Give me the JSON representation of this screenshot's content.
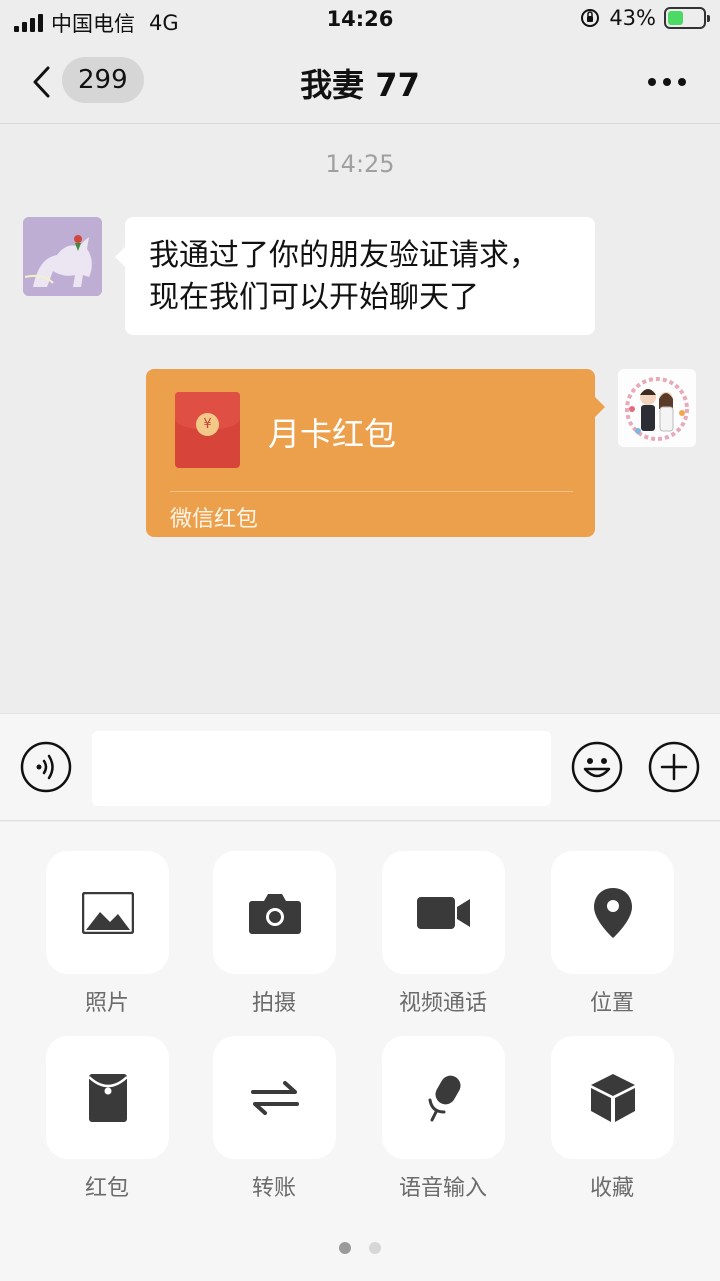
{
  "status_bar": {
    "carrier": "中国电信",
    "network": "4G",
    "time": "14:26",
    "battery_percent": "43%",
    "battery_level": 0.43
  },
  "nav": {
    "unread_count": "299",
    "title": "我妻 77"
  },
  "chat": {
    "timestamp": "14:25",
    "incoming_message_line1": "我通过了你的朋友验证请求，",
    "incoming_message_line2": "现在我们可以开始聊天了",
    "red_packet": {
      "coin_symbol": "¥",
      "title": "月卡红包",
      "footer": "微信红包"
    }
  },
  "panel": {
    "items": [
      {
        "label": "照片",
        "icon": "photo-icon"
      },
      {
        "label": "拍摄",
        "icon": "camera-icon"
      },
      {
        "label": "视频通话",
        "icon": "video-call-icon"
      },
      {
        "label": "位置",
        "icon": "location-icon"
      },
      {
        "label": "红包",
        "icon": "red-packet-icon"
      },
      {
        "label": "转账",
        "icon": "transfer-icon"
      },
      {
        "label": "语音输入",
        "icon": "microphone-icon"
      },
      {
        "label": "收藏",
        "icon": "favorites-icon"
      }
    ],
    "page_count": 2,
    "active_page": 1
  },
  "colors": {
    "background": "#ededed",
    "red_packet": "#eda04c",
    "icon_dark": "#3a3a3a",
    "label_gray": "#6b6b6b"
  }
}
